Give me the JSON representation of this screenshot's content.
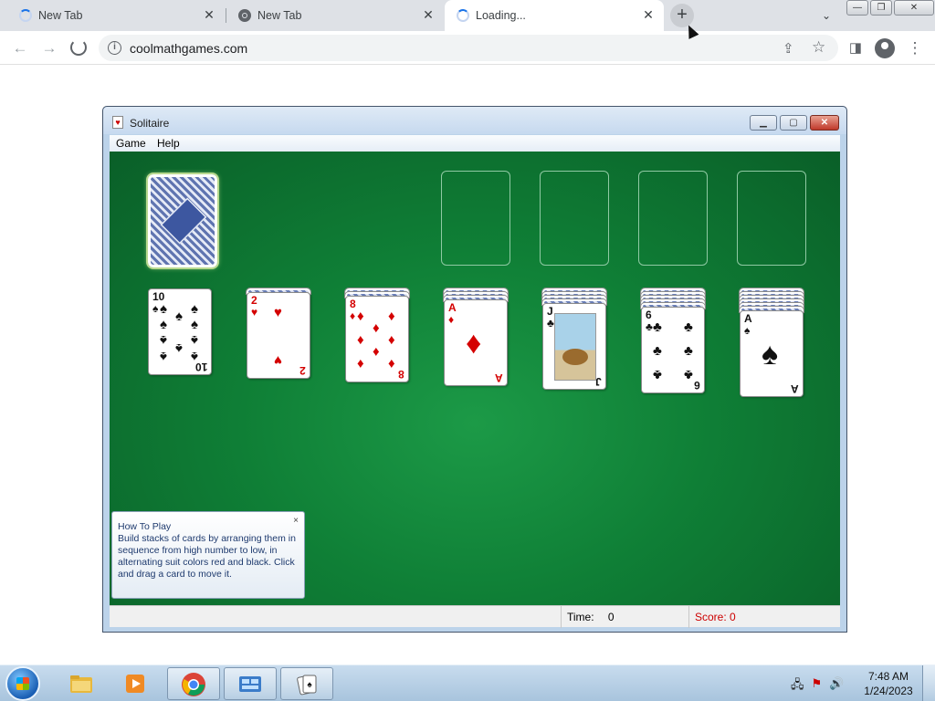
{
  "browser": {
    "tabs": [
      {
        "label": "New Tab",
        "state": "loading"
      },
      {
        "label": "New Tab",
        "state": "chrome"
      },
      {
        "label": "Loading...",
        "state": "loading"
      }
    ],
    "url": "coolmathgames.com"
  },
  "solitaire": {
    "title": "Solitaire",
    "menu": [
      "Game",
      "Help"
    ],
    "tableau": [
      {
        "rank": "10",
        "suit": "♠",
        "color": "black",
        "hidden": 0
      },
      {
        "rank": "2",
        "suit": "♥",
        "color": "red",
        "hidden": 1
      },
      {
        "rank": "8",
        "suit": "♦",
        "color": "red",
        "hidden": 2
      },
      {
        "rank": "A",
        "suit": "♦",
        "color": "red",
        "hidden": 3
      },
      {
        "rank": "J",
        "suit": "♣",
        "color": "black",
        "hidden": 4
      },
      {
        "rank": "6",
        "suit": "♣",
        "color": "black",
        "hidden": 5
      },
      {
        "rank": "A",
        "suit": "♠",
        "color": "black",
        "hidden": 6
      }
    ],
    "how_to_play": {
      "title": "How To Play",
      "text": "Build stacks of cards by arranging them in sequence from high number to low, in alternating suit colors red and black. Click and drag a card to move it.",
      "close": "×"
    },
    "status": {
      "time_label": "Time:",
      "time_value": "0",
      "score_label": "Score:",
      "score_value": "0"
    }
  },
  "taskbar": {
    "time": "7:48 AM",
    "date": "1/24/2023"
  },
  "colors": {
    "felt": "#0f7f36",
    "red_suit": "#d40000",
    "score_text": "#cc0000"
  }
}
